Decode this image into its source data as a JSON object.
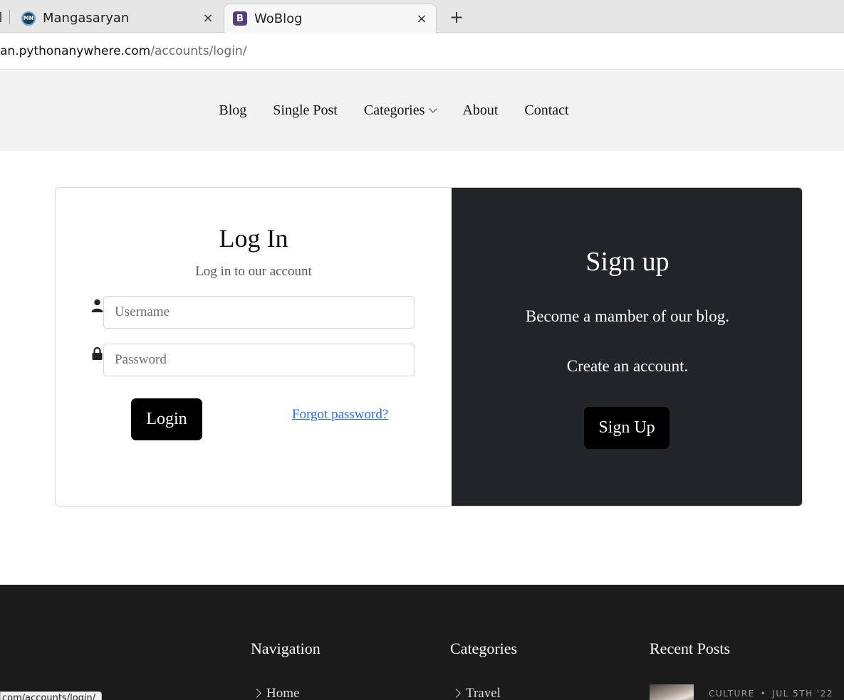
{
  "browser": {
    "tabs": [
      {
        "title": "Mangasaryan",
        "icon": "mn-logo-icon",
        "active": false
      },
      {
        "title": "WoBlog",
        "icon": "bootstrap-icon",
        "active": true
      }
    ],
    "close_glyph": "×",
    "new_tab_glyph": "+",
    "url_host": "an.pythonanywhere.com",
    "url_path": "/accounts/login/",
    "status_url": "com/accounts/login/"
  },
  "nav": {
    "items": [
      "Blog",
      "Single Post",
      "Categories",
      "About",
      "Contact"
    ]
  },
  "login": {
    "title": "Log In",
    "subtitle": "Log in to our account",
    "username_placeholder": "Username",
    "password_placeholder": "Password",
    "login_button": "Login",
    "forgot_link": "Forgot password?"
  },
  "signup": {
    "title": "Sign up",
    "line1": "Become a mamber of our blog.",
    "line2": "Create an account.",
    "button": "Sign Up"
  },
  "footer": {
    "navigation_heading": "Navigation",
    "categories_heading": "Categories",
    "recent_heading": "Recent Posts",
    "navigation_first": "Home",
    "categories_first": "Travel",
    "recent_category": "CULTURE",
    "recent_separator": "•",
    "recent_date": "JUL 5TH '22"
  },
  "colors": {
    "dark_panel": "#212529",
    "footer": "#1b1b1b",
    "link": "#2a6cd6",
    "button": "#000000"
  }
}
